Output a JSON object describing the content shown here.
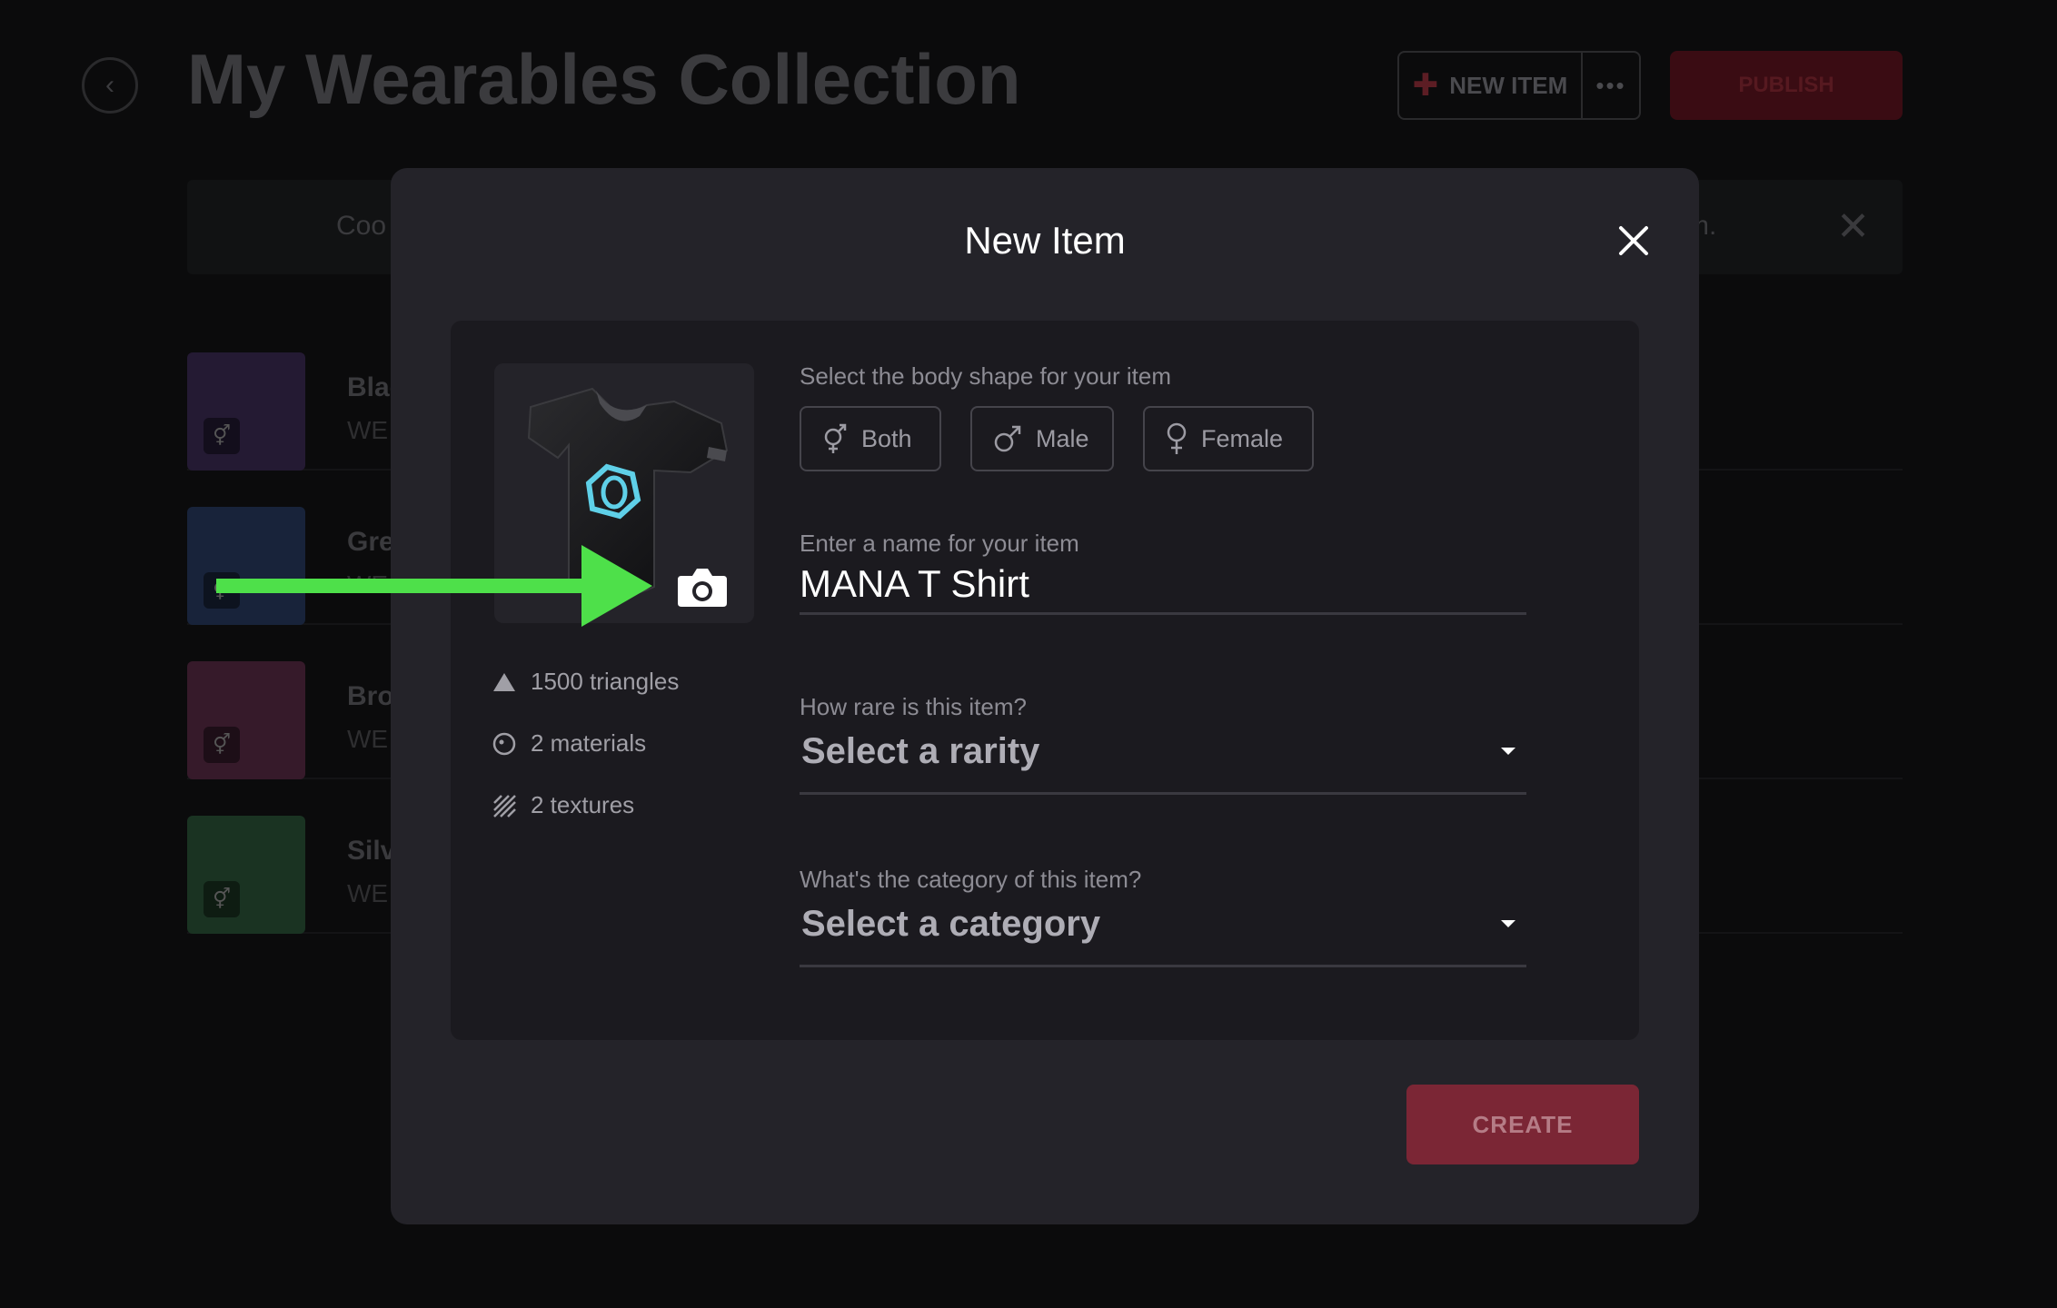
{
  "page": {
    "title": "My Wearables Collection",
    "new_item_label": "NEW ITEM",
    "more_label": "•••",
    "publish_label": "PUBLISH",
    "notice_text_start": "Coo",
    "notice_text_end": "m.",
    "items": [
      {
        "name": "Blac",
        "sub": "WE",
        "color": "#241a33"
      },
      {
        "name": "Gre",
        "sub": "WE",
        "color": "#18233a"
      },
      {
        "name": "Bro",
        "sub": "WE",
        "color": "#361a2a"
      },
      {
        "name": "Silv",
        "sub": "WE",
        "color": "#1a3322"
      }
    ]
  },
  "modal": {
    "title": "New Item",
    "close_icon": "close-icon",
    "stats": {
      "triangles": "1500 triangles",
      "materials": "2 materials",
      "textures": "2 textures"
    },
    "body_shape": {
      "label": "Select the body shape for your item",
      "options": [
        "Both",
        "Male",
        "Female"
      ]
    },
    "name_field": {
      "label": "Enter a name for your item",
      "value": "MANA T Shirt"
    },
    "rarity": {
      "label": "How rare is this item?",
      "placeholder": "Select a rarity"
    },
    "category": {
      "label": "What's the category of this item?",
      "placeholder": "Select a category"
    },
    "create_label": "CREATE"
  },
  "colors": {
    "accent": "#7b2635",
    "annotation_arrow": "#4ee04a"
  }
}
